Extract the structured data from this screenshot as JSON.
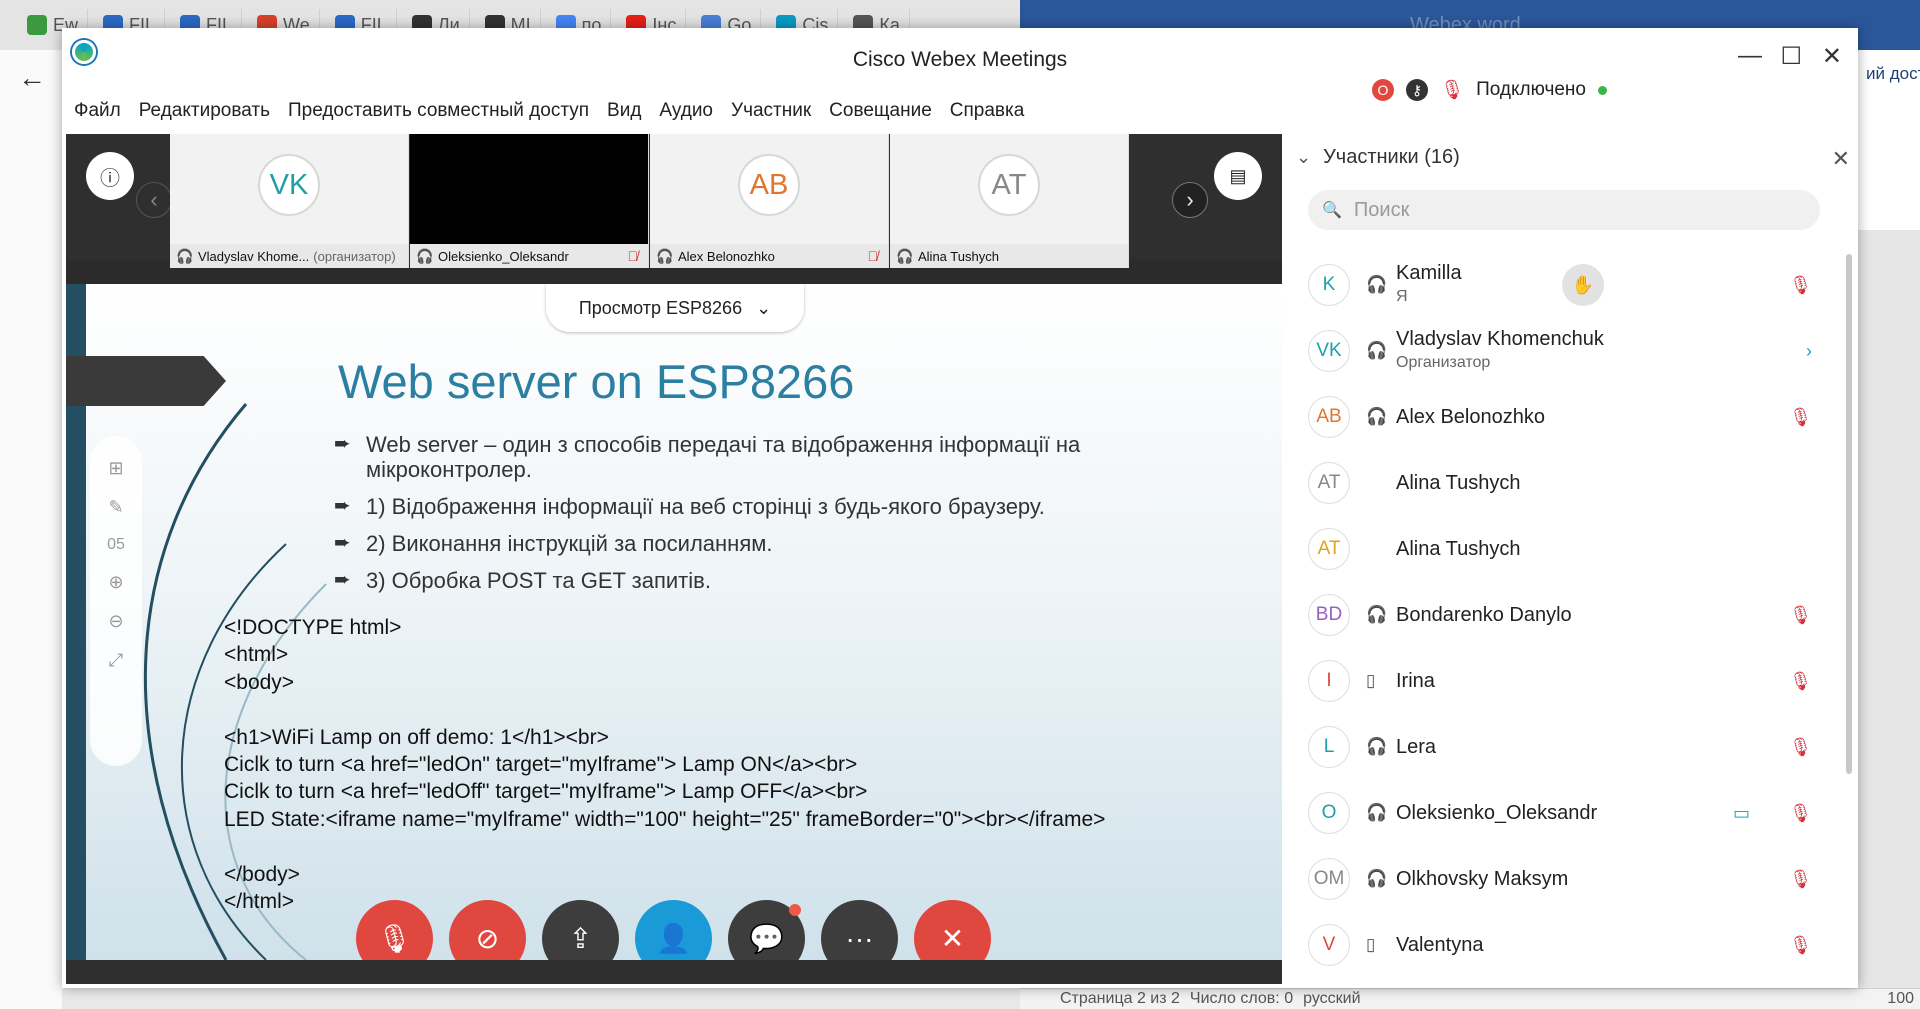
{
  "browser": {
    "tabs": [
      {
        "label": "Ew",
        "icon": "sheets-icon",
        "color": "#3b9a3e"
      },
      {
        "label": "FIL",
        "icon": "doc-icon",
        "color": "#2b69c7"
      },
      {
        "label": "FIL",
        "icon": "doc-icon",
        "color": "#2b69c7"
      },
      {
        "label": "We",
        "icon": "chrome-icon",
        "color": "#d9412c"
      },
      {
        "label": "FIL",
        "icon": "doc-icon",
        "color": "#2b69c7"
      },
      {
        "label": "Ли",
        "icon": "graduation-cap-icon",
        "color": "#333333"
      },
      {
        "label": "MI",
        "icon": "graduation-cap-icon",
        "color": "#333333"
      },
      {
        "label": "по",
        "icon": "google-icon",
        "color": "#4285f4"
      },
      {
        "label": "Інс",
        "icon": "youtube-icon",
        "color": "#e62117"
      },
      {
        "label": "Go",
        "icon": "translate-icon",
        "color": "#4a7fd6"
      },
      {
        "label": "Cis",
        "icon": "webex-icon",
        "color": "#0a9bc7"
      },
      {
        "label": "Ка",
        "icon": "settings-icon",
        "color": "#555555"
      }
    ]
  },
  "word": {
    "title": "Webex word",
    "ribbon_text": "ий дост",
    "status_page": "Страница 2 из 2",
    "status_words": "Число слов: 0",
    "status_lang": "русский",
    "zoom": "100"
  },
  "window": {
    "title": "Cisco Webex Meetings",
    "menu": [
      "Файл",
      "Редактировать",
      "Предоставить совместный доступ",
      "Вид",
      "Аудио",
      "Участник",
      "Совещание",
      "Справка"
    ],
    "status": "Подключено",
    "record_badge": "O"
  },
  "filmstrip": [
    {
      "initials": "VK",
      "color": "#1fa0a8",
      "name": "Vladyslav Khome...",
      "role": "(организатор)",
      "muted": false,
      "video": false
    },
    {
      "initials": "",
      "color": "#000000",
      "name": "Oleksienko_Oleksandr",
      "role": "",
      "muted": true,
      "video": true
    },
    {
      "initials": "AB",
      "color": "#e0772e",
      "name": "Alex Belonozhko",
      "role": "",
      "muted": true,
      "video": false
    },
    {
      "initials": "AT",
      "color": "#888888",
      "name": "Alina Tushych",
      "role": "",
      "muted": false,
      "video": false
    }
  ],
  "share": {
    "view_label": "Просмотр ESP8266",
    "slide_number": "05",
    "slide_title": "Web server on ESP8266",
    "bullets": [
      "Web server – один з способів передачі та відображення інформації на мікроконтролер.",
      "1) Відображення інформації на веб сторінці з будь-якого браузеру.",
      "2) Виконання інструкцій за посиланням.",
      "3) Обробка POST та GET запитів."
    ],
    "code": "<!DOCTYPE html>\n<html>\n<body>\n\n<h1>WiFi Lamp on off demo: 1</h1><br>\nCiclk to turn <a href=\"ledOn\" target=\"myIframe\"> Lamp ON</a><br>\nCiclk to turn <a href=\"ledOff\" target=\"myIframe\"> Lamp OFF</a><br>\nLED State:<iframe name=\"myIframe\" width=\"100\" height=\"25\" frameBorder=\"0\"><br></iframe>\n\n</body>\n</html>"
  },
  "participants": {
    "header": "Участники (16)",
    "search_placeholder": "Поиск",
    "list": [
      {
        "initials": "K",
        "color": "#1fa0a8",
        "name": "Kamilla",
        "sub": "Я",
        "device": "headset-icon",
        "hand": true,
        "muted": true,
        "video": false
      },
      {
        "initials": "VK",
        "color": "#1fa0a8",
        "name": "Vladyslav Khomenchuk",
        "sub": "Организатор",
        "device": "headset-icon",
        "hand": false,
        "muted": false,
        "video": false
      },
      {
        "initials": "AB",
        "color": "#e0772e",
        "name": "Alex Belonozhko",
        "sub": "",
        "device": "headset-icon",
        "hand": false,
        "muted": true,
        "video": false
      },
      {
        "initials": "AT",
        "color": "#888888",
        "name": "Alina Tushych",
        "sub": "",
        "device": "",
        "hand": false,
        "muted": false,
        "video": false
      },
      {
        "initials": "AT",
        "color": "#e0a21f",
        "name": "Alina Tushych",
        "sub": "",
        "device": "",
        "hand": false,
        "muted": false,
        "video": false
      },
      {
        "initials": "BD",
        "color": "#9b5fc0",
        "name": "Bondarenko Danylo",
        "sub": "",
        "device": "headset-icon",
        "hand": false,
        "muted": true,
        "video": false
      },
      {
        "initials": "I",
        "color": "#e0473f",
        "name": "Irina",
        "sub": "",
        "device": "phone-icon",
        "hand": false,
        "muted": true,
        "video": false
      },
      {
        "initials": "L",
        "color": "#1fa0a8",
        "name": "Lera",
        "sub": "",
        "device": "headset-icon",
        "hand": false,
        "muted": true,
        "video": false
      },
      {
        "initials": "O",
        "color": "#1fa0a8",
        "name": "Oleksienko_Oleksandr",
        "sub": "",
        "device": "headset-icon",
        "hand": false,
        "muted": true,
        "video": true
      },
      {
        "initials": "OM",
        "color": "#888888",
        "name": "Olkhovsky Maksym",
        "sub": "",
        "device": "headset-icon",
        "hand": false,
        "muted": true,
        "video": false
      },
      {
        "initials": "V",
        "color": "#e0473f",
        "name": "Valentyna",
        "sub": "",
        "device": "phone-icon",
        "hand": false,
        "muted": true,
        "video": false
      }
    ]
  },
  "controls": [
    {
      "name": "mute-button",
      "icon": "mic-muted-icon",
      "color": "#e0473f"
    },
    {
      "name": "video-button",
      "icon": "camera-off-icon",
      "color": "#e0473f"
    },
    {
      "name": "share-button",
      "icon": "share-icon",
      "color": "#3d3d3d"
    },
    {
      "name": "participants-button",
      "icon": "participants-icon",
      "color": "#1a9ad6"
    },
    {
      "name": "chat-button",
      "icon": "chat-icon",
      "color": "#3d3d3d"
    },
    {
      "name": "more-button",
      "icon": "more-icon",
      "color": "#3d3d3d"
    },
    {
      "name": "leave-button",
      "icon": "close-icon",
      "color": "#e0473f"
    }
  ]
}
